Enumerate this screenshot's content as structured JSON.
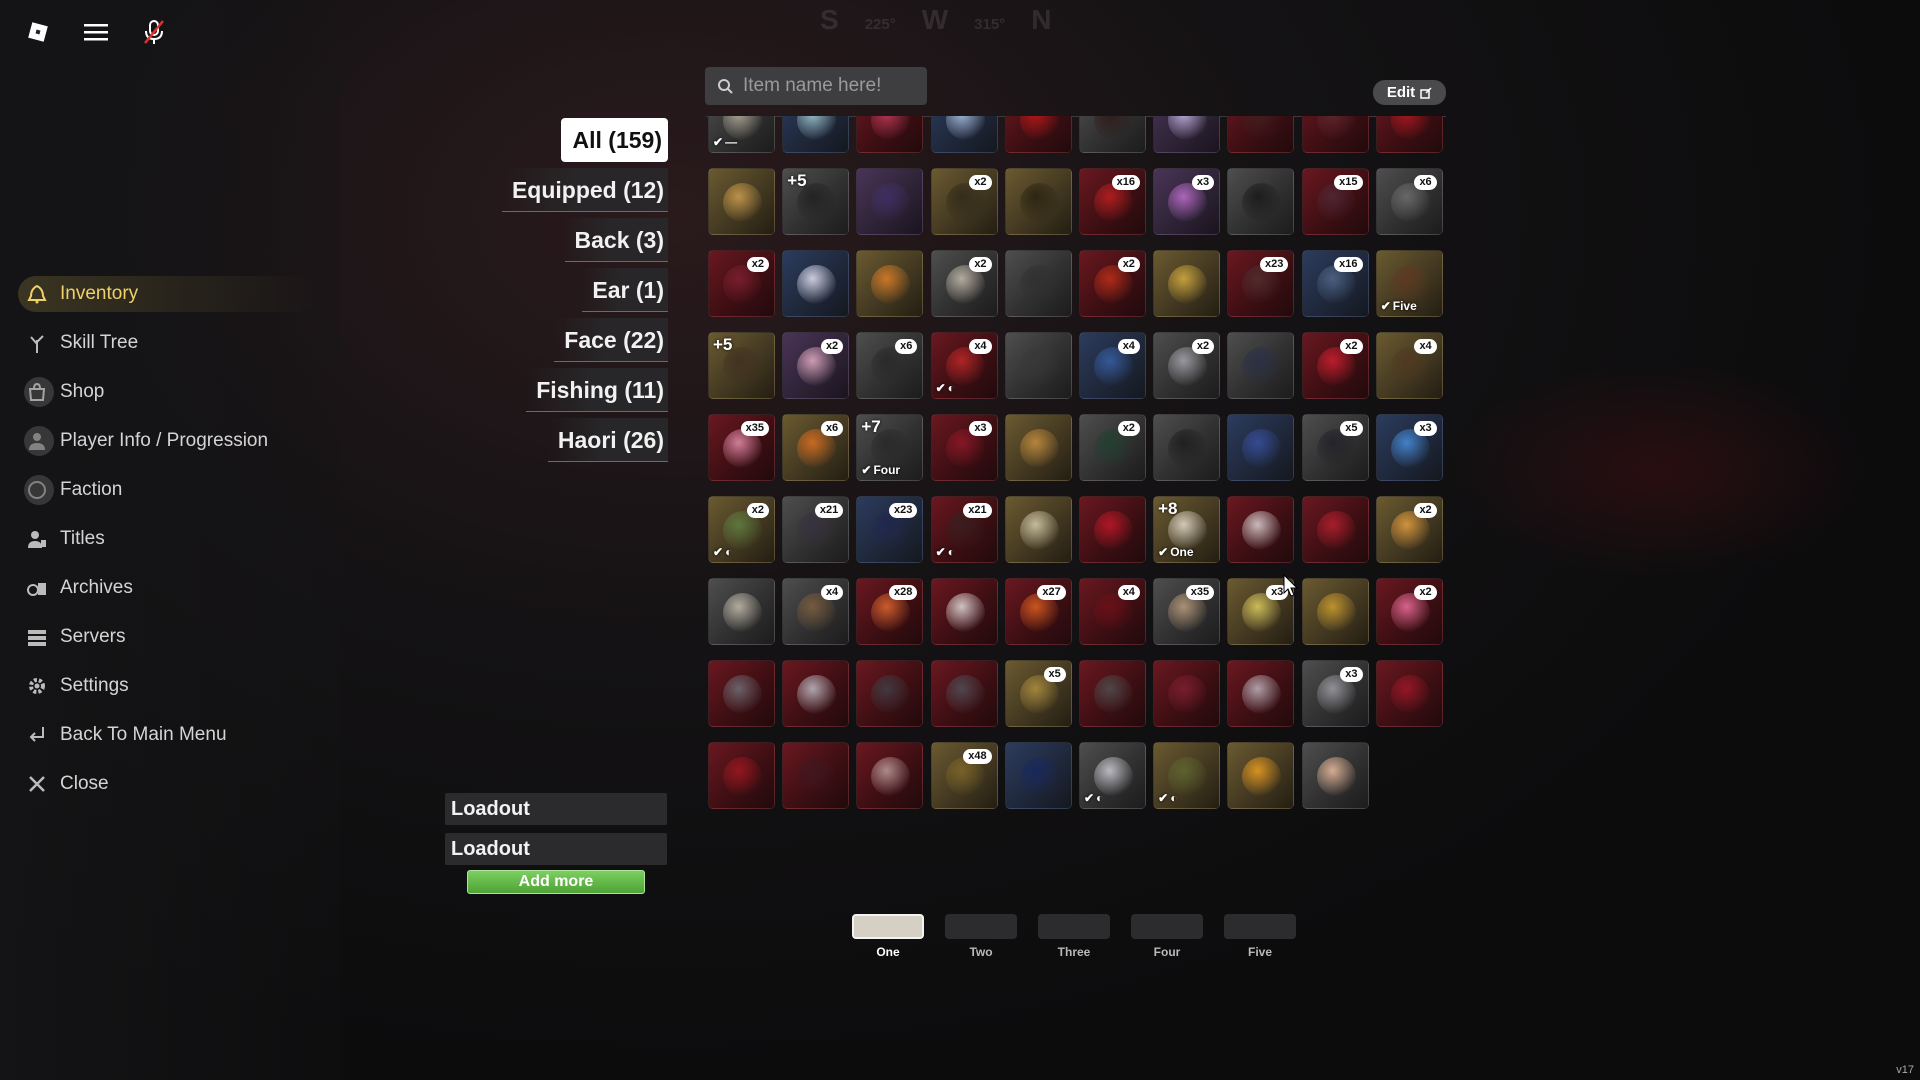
{
  "compass": {
    "s": "S",
    "deg1": "225°",
    "w": "W",
    "deg2": "315°",
    "n": "N"
  },
  "search": {
    "placeholder": "Item name here!"
  },
  "edit_label": "Edit",
  "menu": [
    {
      "label": "Inventory",
      "icon": "bell-icon",
      "active": true
    },
    {
      "label": "Skill Tree",
      "icon": "tree-icon"
    },
    {
      "label": "Shop",
      "icon": "shop-icon"
    },
    {
      "label": "Player Info / Progression",
      "icon": "player-icon"
    },
    {
      "label": "Faction",
      "icon": "faction-icon"
    },
    {
      "label": "Titles",
      "icon": "person-icon"
    },
    {
      "label": "Archives",
      "icon": "archive-icon"
    },
    {
      "label": "Servers",
      "icon": "server-icon"
    },
    {
      "label": "Settings",
      "icon": "gear-icon"
    },
    {
      "label": "Back To Main Menu",
      "icon": "return-icon"
    },
    {
      "label": "Close",
      "icon": "close-icon"
    }
  ],
  "categories": [
    {
      "label": "All (159)",
      "active": true
    },
    {
      "label": "Equipped (12)"
    },
    {
      "label": "Back (3)"
    },
    {
      "label": "Ear (1)"
    },
    {
      "label": "Face (22)"
    },
    {
      "label": "Fishing (11)"
    },
    {
      "label": "Haori (26)"
    }
  ],
  "items": [
    {
      "c": "gray",
      "a": "#b8b0a0",
      "check": "—"
    },
    {
      "c": "blue",
      "a": "#a8d0d8"
    },
    {
      "c": "red",
      "a": "#c03a5a"
    },
    {
      "c": "blue",
      "a": "#b0c8e8"
    },
    {
      "c": "red",
      "a": "#c01818"
    },
    {
      "c": "gray",
      "a": "#301818"
    },
    {
      "c": "purple",
      "a": "#c8b8e8"
    },
    {
      "c": "red",
      "a": "#402020"
    },
    {
      "c": "red",
      "a": "#602830"
    },
    {
      "c": "red",
      "a": "#b01820"
    },
    {
      "c": "gold",
      "a": "#d0a050"
    },
    {
      "c": "gray",
      "a": "#202020",
      "plus": "+5"
    },
    {
      "c": "purple",
      "a": "#403068"
    },
    {
      "c": "gold",
      "a": "#302818",
      "badge": "x2"
    },
    {
      "c": "gold",
      "a": "#282010"
    },
    {
      "c": "red",
      "a": "#c02020",
      "badge": "x16"
    },
    {
      "c": "purple",
      "a": "#c070d0",
      "badge": "x3"
    },
    {
      "c": "gray",
      "a": "#181818"
    },
    {
      "c": "red",
      "a": "#502838",
      "badge": "x15"
    },
    {
      "c": "gray",
      "a": "#707070",
      "badge": "x6"
    },
    {
      "c": "red",
      "a": "#802030",
      "badge": "x2"
    },
    {
      "c": "blue",
      "a": "#e8e8f8"
    },
    {
      "c": "gold",
      "a": "#e08028"
    },
    {
      "c": "gray",
      "a": "#c8c0b0",
      "badge": "x2"
    },
    {
      "c": "gray",
      "a": "#303030"
    },
    {
      "c": "red",
      "a": "#c03018",
      "badge": "x2"
    },
    {
      "c": "gold",
      "a": "#d8b040"
    },
    {
      "c": "red",
      "a": "#503030",
      "badge": "x23"
    },
    {
      "c": "blue",
      "a": "#506888",
      "badge": "x16"
    },
    {
      "c": "gold",
      "a": "#603820",
      "check": "Five"
    },
    {
      "c": "gold",
      "a": "#403020",
      "plus": "+5"
    },
    {
      "c": "purple",
      "a": "#e8b0c8",
      "badge": "x2"
    },
    {
      "c": "gray",
      "a": "#282828",
      "badge": "x6"
    },
    {
      "c": "red",
      "a": "#c02828",
      "badge": "x4",
      "check": "◐"
    },
    {
      "c": "gray",
      "a": "#383838"
    },
    {
      "c": "blue",
      "a": "#3860a8",
      "badge": "x4"
    },
    {
      "c": "gray",
      "a": "#a8a8b0",
      "badge": "x2"
    },
    {
      "c": "gray",
      "a": "#283048"
    },
    {
      "c": "red",
      "a": "#d02030",
      "badge": "x2"
    },
    {
      "c": "gold",
      "a": "#503820",
      "badge": "x4"
    },
    {
      "c": "red",
      "a": "#e890b0",
      "badge": "x35"
    },
    {
      "c": "gold",
      "a": "#e07020",
      "badge": "x6"
    },
    {
      "c": "gray",
      "a": "#282828",
      "plus": "+7",
      "check": "Four"
    },
    {
      "c": "red",
      "a": "#901828",
      "badge": "x3"
    },
    {
      "c": "gold",
      "a": "#c89040"
    },
    {
      "c": "gray",
      "a": "#204030",
      "badge": "x2"
    },
    {
      "c": "gray",
      "a": "#1c1c1c"
    },
    {
      "c": "blue",
      "a": "#3850a0"
    },
    {
      "c": "gray",
      "a": "#202028",
      "badge": "x5"
    },
    {
      "c": "blue",
      "a": "#4890e0",
      "badge": "x3"
    },
    {
      "c": "gold",
      "a": "#608040",
      "badge": "x2",
      "check": "◐"
    },
    {
      "c": "gray",
      "a": "#383040",
      "badge": "x21"
    },
    {
      "c": "blue",
      "a": "#202850",
      "badge": "x23"
    },
    {
      "c": "red",
      "a": "#382020",
      "badge": "x21",
      "check": "◐"
    },
    {
      "c": "gold",
      "a": "#d8d0b0"
    },
    {
      "c": "red",
      "a": "#c01828"
    },
    {
      "c": "gold",
      "a": "#e8e0d0",
      "plus": "+8",
      "check": "One"
    },
    {
      "c": "red",
      "a": "#e0d8d8"
    },
    {
      "c": "red",
      "a": "#b82030"
    },
    {
      "c": "gold",
      "a": "#e8a040",
      "badge": "x2"
    },
    {
      "c": "gray",
      "a": "#c8c0b0"
    },
    {
      "c": "gray",
      "a": "#806040",
      "badge": "x4"
    },
    {
      "c": "red",
      "a": "#e06830",
      "badge": "x28"
    },
    {
      "c": "red",
      "a": "#e8e0e0"
    },
    {
      "c": "red",
      "a": "#e06020",
      "badge": "x27"
    },
    {
      "c": "red",
      "a": "#701018",
      "badge": "x4"
    },
    {
      "c": "gray",
      "a": "#c0a080",
      "badge": "x35"
    },
    {
      "c": "gold",
      "a": "#e0d060",
      "badge": "x3"
    },
    {
      "c": "gold",
      "a": "#d0a030"
    },
    {
      "c": "red",
      "a": "#f070a0",
      "badge": "x2"
    },
    {
      "c": "red",
      "a": "#707078"
    },
    {
      "c": "red",
      "a": "#c0c0c8"
    },
    {
      "c": "red",
      "a": "#404048"
    },
    {
      "c": "red",
      "a": "#505058"
    },
    {
      "c": "gold",
      "a": "#b09040",
      "badge": "x5"
    },
    {
      "c": "red",
      "a": "#505050"
    },
    {
      "c": "red",
      "a": "#802030"
    },
    {
      "c": "red",
      "a": "#c0b8c0"
    },
    {
      "c": "gray",
      "a": "#a0a0a8",
      "badge": "x3"
    },
    {
      "c": "red",
      "a": "#a01828"
    },
    {
      "c": "red",
      "a": "#a01820"
    },
    {
      "c": "red",
      "a": "#401820"
    },
    {
      "c": "red",
      "a": "#c0a0a0"
    },
    {
      "c": "gold",
      "a": "#806828",
      "badge": "x48"
    },
    {
      "c": "blue",
      "a": "#182860"
    },
    {
      "c": "gray",
      "a": "#d0d0d8",
      "check": "◐"
    },
    {
      "c": "gold",
      "a": "#606830",
      "check": "◐"
    },
    {
      "c": "gold",
      "a": "#f0a020"
    },
    {
      "c": "gray",
      "a": "#f0c0a0"
    }
  ],
  "loadouts": [
    "Loadout",
    "Loadout"
  ],
  "add_more_label": "Add more",
  "slots": [
    {
      "label": "One",
      "active": true
    },
    {
      "label": "Two"
    },
    {
      "label": "Three"
    },
    {
      "label": "Four"
    },
    {
      "label": "Five"
    }
  ],
  "version": "v17"
}
